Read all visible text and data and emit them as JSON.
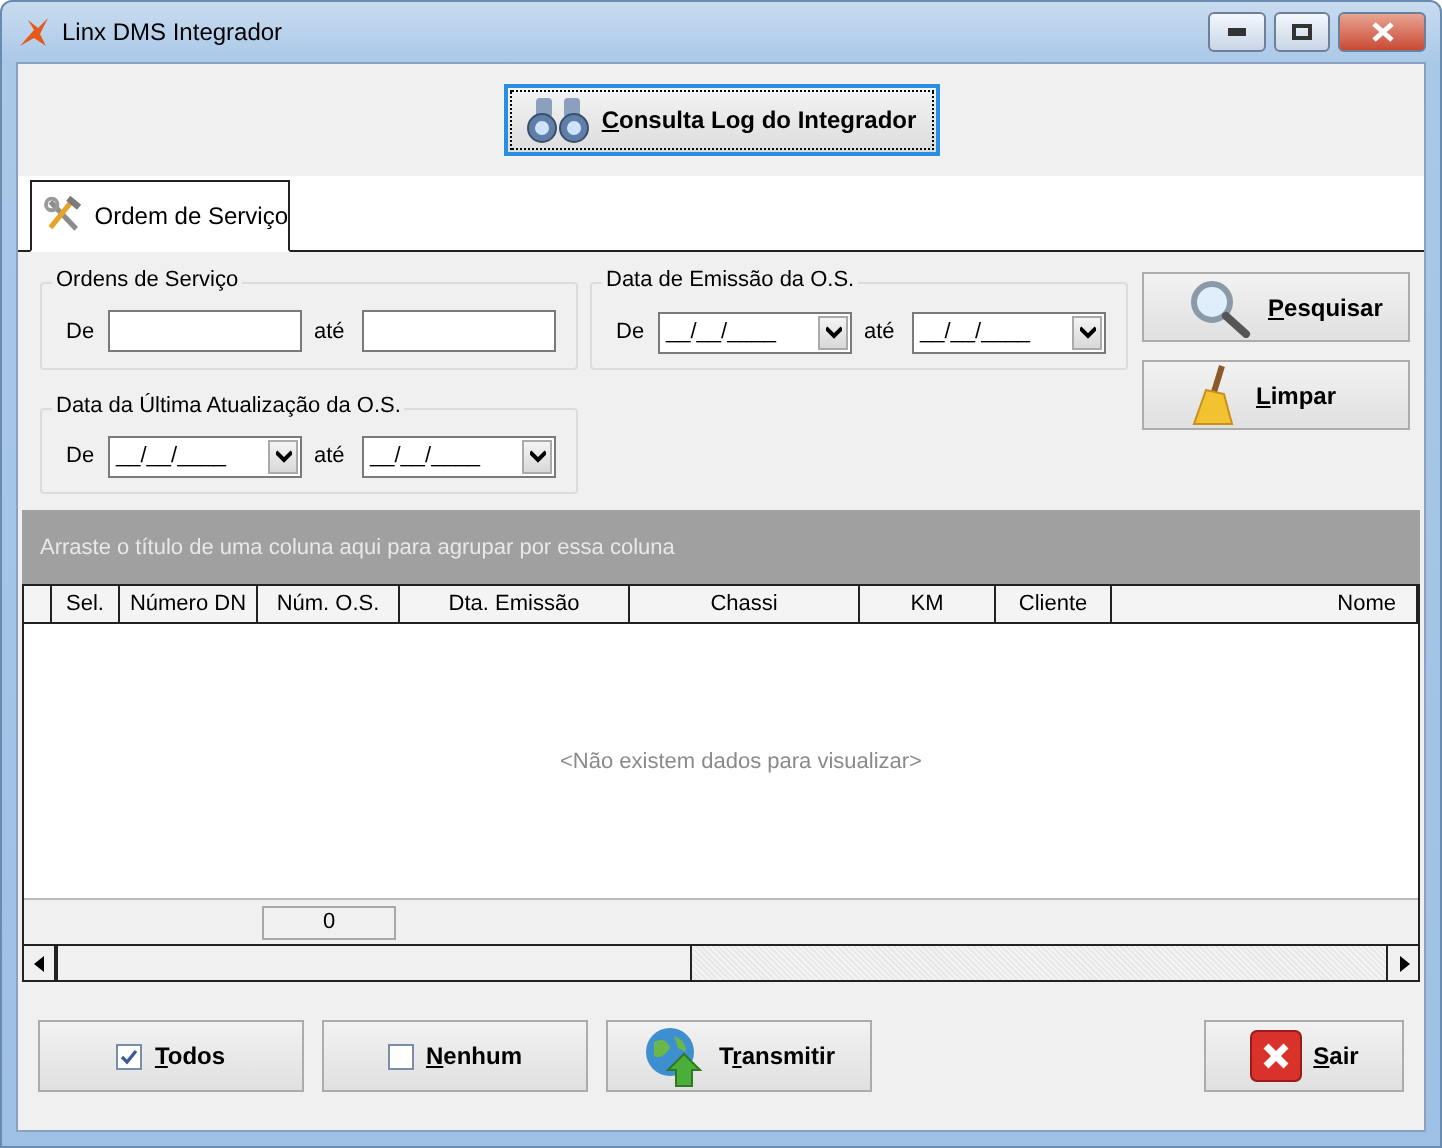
{
  "window": {
    "title": "Linx DMS Integrador"
  },
  "top_button": {
    "label": "Consulta Log do Integrador"
  },
  "tabs": [
    {
      "label": "Ordem de Serviço",
      "selected": true
    }
  ],
  "groups": [
    {
      "kind": "text",
      "title": "Ordens de Serviço",
      "from_label": "De",
      "to_label": "até"
    },
    {
      "kind": "date",
      "title": "Data de Emissão da O.S.",
      "from_label": "De",
      "to_label": "até",
      "from_value": "__/__/____",
      "to_value": "__/__/____"
    },
    {
      "kind": "date",
      "title": "Data da Última Atualização da O.S.",
      "from_label": "De",
      "to_label": "até",
      "from_value": "__/__/____",
      "to_value": "__/__/____"
    }
  ],
  "actions": [
    {
      "kind": "search",
      "label": "Pesquisar"
    },
    {
      "kind": "clear",
      "label": "Limpar"
    }
  ],
  "grid": {
    "group_hint": "Arraste o título de uma coluna aqui para agrupar por essa coluna",
    "columns": [
      "Sel.",
      "Número DN",
      "Núm. O.S.",
      "Dta. Emissão",
      "Chassi",
      "KM",
      "Cliente",
      "Nome"
    ],
    "empty_text": "<Não existem dados para visualizar>",
    "footer_count": "0"
  },
  "bottom_buttons": [
    {
      "kind": "checkbox",
      "label": "Todos",
      "checked": true
    },
    {
      "kind": "checkbox",
      "label": "Nenhum",
      "checked": false
    },
    {
      "kind": "transmit",
      "label": "Transmitir"
    },
    {
      "kind": "exit",
      "label": "Sair"
    }
  ]
}
